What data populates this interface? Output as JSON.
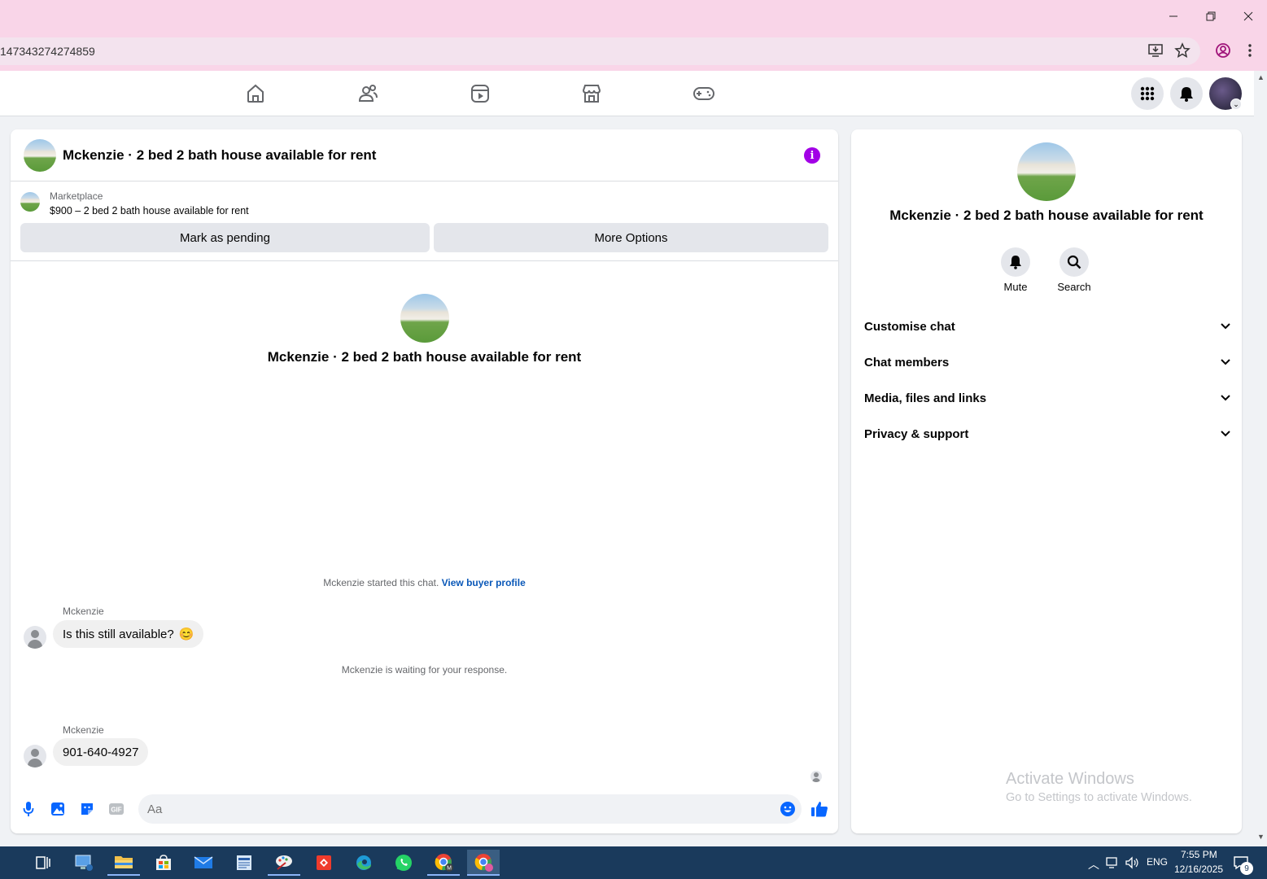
{
  "browser": {
    "url": "147343274274859"
  },
  "chat": {
    "title": "Mckenzie · 2 bed 2 bath house available for rent",
    "listing_category": "Marketplace",
    "listing_price_title": "$900 – 2 bed 2 bath house available for rent",
    "mark_pending_label": "Mark as pending",
    "more_options_label": "More Options",
    "center_title": "Mckenzie · 2 bed 2 bath house available for rent",
    "started_text": "Mckenzie started this chat.",
    "view_buyer_profile": "View buyer profile",
    "waiting_text": "Mckenzie is waiting for your response.",
    "messages": [
      {
        "sender": "Mckenzie",
        "text": "Is this still available?",
        "emoji": "😊"
      },
      {
        "sender": "Mckenzie",
        "text": "901-640-4927"
      }
    ],
    "composer_placeholder": "Aa"
  },
  "info_panel": {
    "title": "Mckenzie · 2 bed 2 bath house available for rent",
    "mute_label": "Mute",
    "search_label": "Search",
    "sections": [
      "Customise chat",
      "Chat members",
      "Media, files and links",
      "Privacy & support"
    ]
  },
  "watermark": {
    "line1": "Activate Windows",
    "line2": "Go to Settings to activate Windows."
  },
  "taskbar": {
    "lang": "ENG",
    "time": "7:55 PM",
    "date": "12/16/2025",
    "notif_count": "9"
  },
  "colors": {
    "accent_purple": "#a200e6",
    "fb_blue": "#0866ff",
    "link_blue": "#0a58b8",
    "chrome_pink": "#f9d5e8"
  }
}
